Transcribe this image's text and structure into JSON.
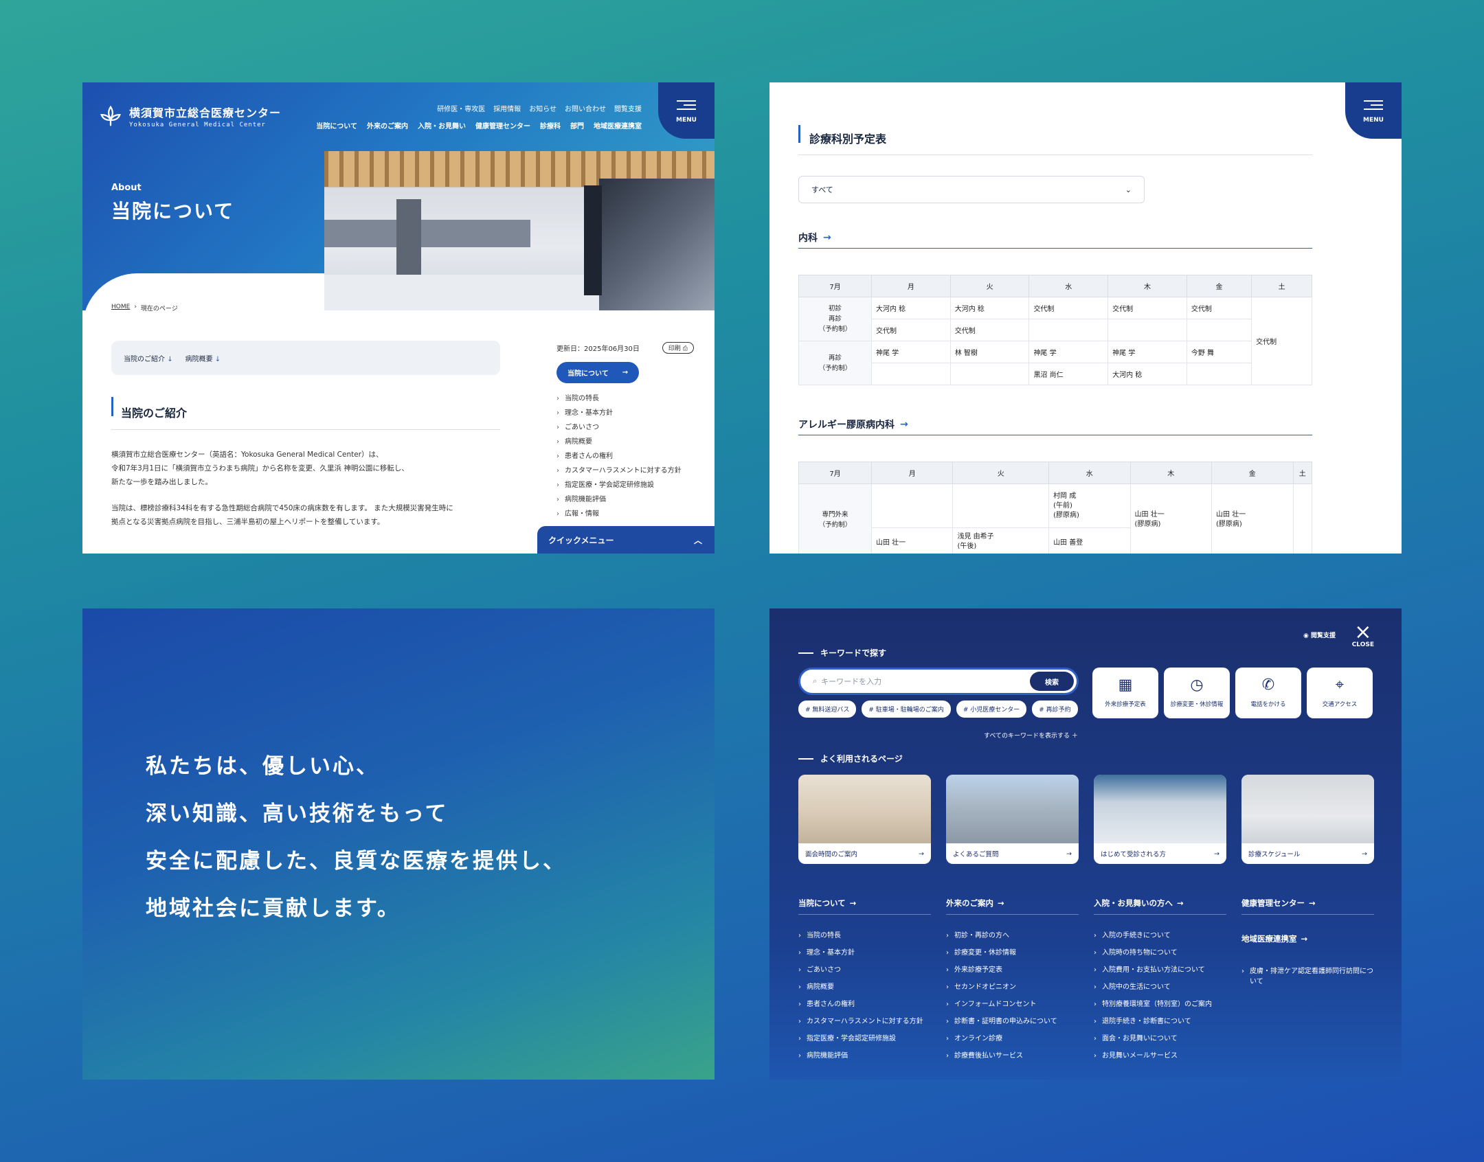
{
  "header": {
    "logo_jp": "横須賀市立総合医療センター",
    "logo_en": "Yokosuka General Medical Center",
    "util_nav": [
      "研修医・専攻医",
      "採用情報",
      "お知らせ",
      "お問い合わせ",
      "閲覧支援"
    ],
    "main_nav": [
      "当院について",
      "外来のご案内",
      "入院・お見舞い",
      "健康管理センター",
      "診療科",
      "部門",
      "地域医療連携室"
    ],
    "menu_label": "MENU"
  },
  "hero": {
    "en": "About",
    "jp": "当院について"
  },
  "breadcrumb": {
    "home": "HOME",
    "current": "現在のページ"
  },
  "anchors": [
    "当院のご紹介",
    "病院概要"
  ],
  "intro": {
    "title": "当院のご紹介",
    "p1_l1": "横須賀市立総合医療センター（英語名：Yokosuka General Medical Center）は、",
    "p1_l2": "令和7年3月1日に「横須賀市立うわまち病院」から名称を変更、久里浜 神明公園に移転し、",
    "p1_l3": "新たな一歩を踏み出しました。",
    "p2_l1": "当院は、標榜診療科34科を有する急性期総合病院で450床の病床数を有します。 また大規模災害発生時に",
    "p2_l2": "拠点となる災害拠点病院を目指し、三浦半島初の屋上ヘリポートを整備しています。"
  },
  "sidebar": {
    "updated": "更新日：2025年06月30日",
    "print": "印刷",
    "pill": "当院について",
    "items": [
      "当院の特長",
      "理念・基本方針",
      "ごあいさつ",
      "病院概要",
      "患者さんの権利",
      "カスタマーハラスメントに対する方針",
      "指定医療・学会認定研修施設",
      "病院機能評価",
      "広報・情報"
    ]
  },
  "quick_menu": "クイックメニュー",
  "schedule": {
    "title": "診療科別予定表",
    "select": "すべて",
    "dept1": "内科",
    "dept2": "アレルギー膠原病内科",
    "month": "7月",
    "days": [
      "月",
      "火",
      "水",
      "木",
      "金",
      "土"
    ],
    "row1_label": "初診\n再診\n（予約制）",
    "row2_label": "再診\n（予約制）",
    "r1a": [
      "大河内 稔",
      "大河内 稔",
      "交代制",
      "交代制",
      "交代制"
    ],
    "r1b": [
      "交代制",
      "交代制",
      "",
      "",
      ""
    ],
    "sat": "交代制",
    "r2a": [
      "神尾 学",
      "林 智樹",
      "神尾 学",
      "神尾 学",
      "今野 舞"
    ],
    "r2b": [
      "",
      "",
      "黒沼 尚仁",
      "大河内 稔",
      ""
    ],
    "row3_label": "専門外来\n（予約制）",
    "r3_wed": "村岡 成\n(午前)\n(膠原病)",
    "r3_thu": "山田 壮一\n(膠原病)",
    "r3_fri": "山田 壮一\n(膠原病)",
    "r3_mon": "山田 壮一",
    "r3_tue": "浅見 由希子\n(午後)",
    "r3_wed2": "山田 善登"
  },
  "philosophy": [
    "私たちは、優しい心、",
    "深い知識、高い技術をもって",
    "安全に配慮した、良質な医療を提供し、",
    "地域社会に貢献します。"
  ],
  "menu_panel": {
    "close": "CLOSE",
    "accessibility": "閲覧支援",
    "keyword_head": "キーワードで探す",
    "search_placeholder": "キーワードを入力",
    "search_button": "検索",
    "tags": [
      "# 無料送迎バス",
      "# 駐車場・駐輪場のご案内",
      "# 小児医療センター",
      "# 再診予約"
    ],
    "all_keywords": "すべてのキーワードを表示する ＋",
    "tiles": [
      "外来診療予定表",
      "診療変更・休診情報",
      "電話をかける",
      "交通アクセス"
    ],
    "popular_head": "よく利用されるページ",
    "cards": [
      "面会時間のご案内",
      "よくあるご質問",
      "はじめて受診される方",
      "診療スケジュール"
    ],
    "col1_head": "当院について",
    "col1": [
      "当院の特長",
      "理念・基本方針",
      "ごあいさつ",
      "病院概要",
      "患者さんの権利",
      "カスタマーハラスメントに対する方針",
      "指定医療・学会認定研修施設",
      "病院機能評価"
    ],
    "col2_head": "外来のご案内",
    "col2": [
      "初診・再診の方へ",
      "診療変更・休診情報",
      "外来診療予定表",
      "セカンドオピニオン",
      "インフォームドコンセント",
      "診断書・証明書の申込みについて",
      "オンライン診療",
      "診療費後払いサービス"
    ],
    "col3_head": "入院・お見舞いの方へ",
    "col3": [
      "入院の手続きについて",
      "入院時の持ち物について",
      "入院費用・お支払い方法について",
      "入院中の生活について",
      "特別療養環境室（特別室）のご案内",
      "退院手続き・診断書について",
      "面会・お見舞いについて",
      "お見舞いメールサービス"
    ],
    "col4_head": "健康管理センター",
    "col4_head2": "地域医療連携室",
    "col4": [
      "皮膚・排泄ケア認定看護師同行訪問について"
    ]
  }
}
